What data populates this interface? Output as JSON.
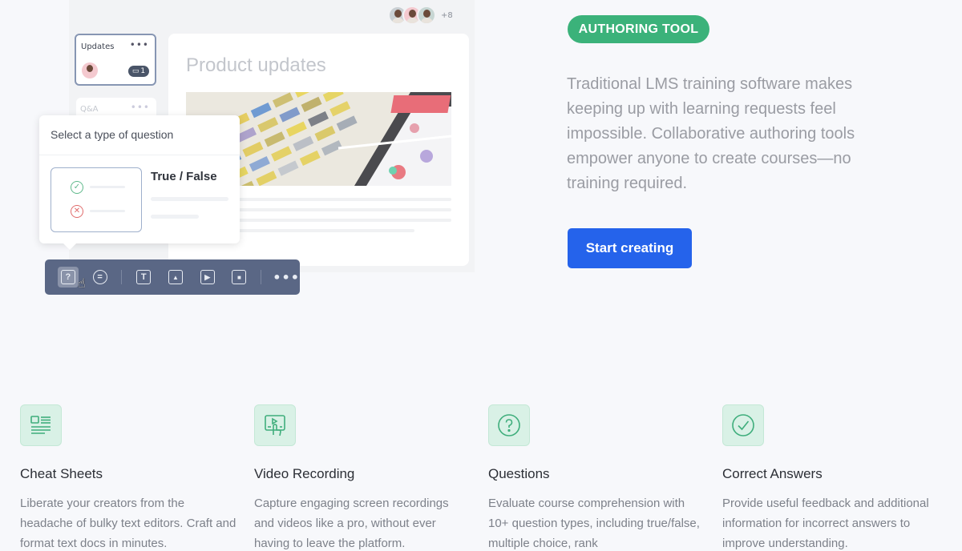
{
  "mockup": {
    "collaborators_more": "+8",
    "side_cards": [
      {
        "title": "Updates",
        "menu": "•••",
        "comment_count": "1"
      },
      {
        "title": "Q&A",
        "menu": "•••"
      }
    ],
    "doc_title": "Product updates",
    "popover": {
      "title": "Select a type of question",
      "option_label": "True / False"
    },
    "toolbar": {
      "items": [
        {
          "icon": "question-icon",
          "glyph": "?",
          "active": true
        },
        {
          "icon": "comment-icon",
          "glyph": "="
        },
        {
          "icon": "text-icon",
          "glyph": "T"
        },
        {
          "icon": "image-icon",
          "glyph": "▲"
        },
        {
          "icon": "video-play-icon",
          "glyph": "▶"
        },
        {
          "icon": "record-icon",
          "glyph": "■"
        }
      ],
      "more": "•••"
    }
  },
  "hero": {
    "badge": "AUTHORING TOOL",
    "description": "Traditional LMS training software makes keeping up with learning requests feel impossible. Collaborative authoring tools empower anyone to create courses—no training required.",
    "cta_label": "Start creating"
  },
  "features": [
    {
      "icon": "document-icon",
      "title": "Cheat Sheets",
      "description": "Liberate your creators from the headache of bulky text editors. Craft and format text docs in minutes."
    },
    {
      "icon": "screen-recording-icon",
      "title": "Video Recording",
      "description": "Capture engaging screen recordings and videos like a pro, without ever having to leave the platform."
    },
    {
      "icon": "question-circle-icon",
      "title": "Questions",
      "description": "Evaluate course comprehension with 10+ question types, including true/false, multiple choice, rank"
    },
    {
      "icon": "check-circle-icon",
      "title": "Correct Answers",
      "description": "Provide useful feedback and additional information for incorrect answers to improve understanding."
    }
  ],
  "colors": {
    "badge_green": "#3bb27a",
    "cta_blue": "#2563eb",
    "toolbar": "#5a6785",
    "feature_icon_bg": "#d9f1e6"
  }
}
